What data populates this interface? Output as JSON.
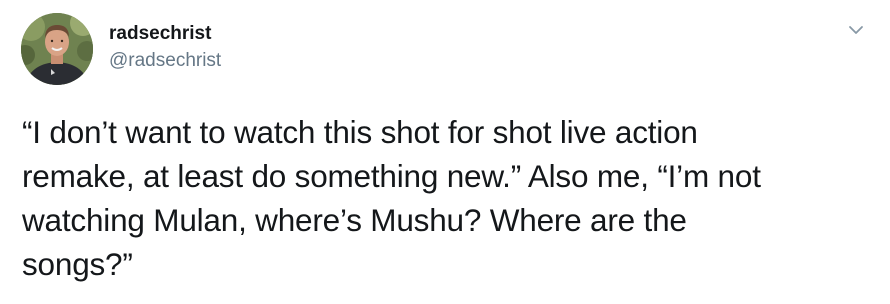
{
  "author": {
    "display_name": "radsechrist",
    "handle": "@radsechrist",
    "avatar_icon": "profile-photo"
  },
  "tweet": {
    "text_lines": [
      "“I don’t want to watch this shot for shot live action",
      "remake, at least do something new.” Also me, “I’m not",
      "watching Mulan, where’s Mushu? Where are the",
      "songs?”"
    ]
  },
  "actions": {
    "menu_icon": "chevron-down-icon"
  },
  "colors": {
    "primary_text": "#14171a",
    "secondary_text": "#657786",
    "caret": "#8899a6",
    "background": "#ffffff"
  }
}
